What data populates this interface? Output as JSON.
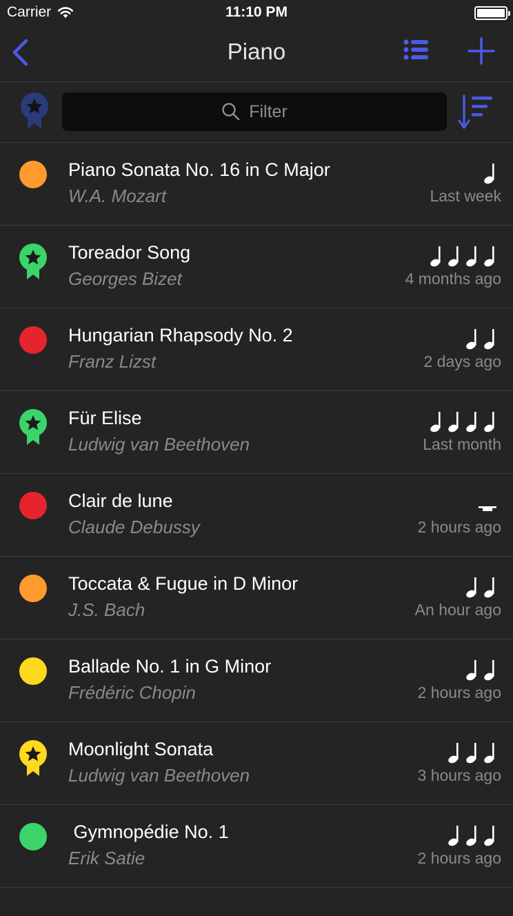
{
  "status_bar": {
    "carrier": "Carrier",
    "time": "11:10 PM"
  },
  "nav": {
    "title": "Piano",
    "accent": "#4a5be8"
  },
  "filter": {
    "placeholder": "Filter"
  },
  "colors": {
    "orange": "#ff9a2e",
    "green": "#3bd46a",
    "red": "#e5242e",
    "yellow": "#ffd820",
    "navy": "#2a3a7a"
  },
  "pieces": [
    {
      "title": "Piano Sonata No. 16 in C Major",
      "composer": "W.A. Mozart",
      "time": "Last week",
      "status": "dot",
      "color": "orange",
      "notes": 1
    },
    {
      "title": "Toreador Song",
      "composer": "Georges Bizet",
      "time": "4 months ago",
      "status": "medal",
      "color": "green",
      "notes": 4
    },
    {
      "title": "Hungarian Rhapsody No. 2",
      "composer": "Franz Lizst",
      "time": "2 days ago",
      "status": "dot",
      "color": "red",
      "notes": 2
    },
    {
      "title": "Für Elise",
      "composer": "Ludwig van Beethoven",
      "time": "Last month",
      "status": "medal",
      "color": "green",
      "notes": 4
    },
    {
      "title": "Clair de lune",
      "composer": "Claude Debussy",
      "time": "2 hours ago",
      "status": "dot",
      "color": "red",
      "notes": 0
    },
    {
      "title": "Toccata & Fugue in D Minor",
      "composer": "J.S. Bach",
      "time": "An hour ago",
      "status": "dot",
      "color": "orange",
      "notes": 2
    },
    {
      "title": "Ballade No. 1 in G Minor",
      "composer": "Frédéric Chopin",
      "time": "2 hours ago",
      "status": "dot",
      "color": "yellow",
      "notes": 2
    },
    {
      "title": "Moonlight Sonata",
      "composer": "Ludwig van Beethoven",
      "time": "3 hours ago",
      "status": "medal",
      "color": "yellow",
      "notes": 3
    },
    {
      "title": " Gymnopédie No. 1",
      "composer": "Erik Satie",
      "time": "2 hours ago",
      "status": "dot",
      "color": "green",
      "notes": 3
    }
  ]
}
